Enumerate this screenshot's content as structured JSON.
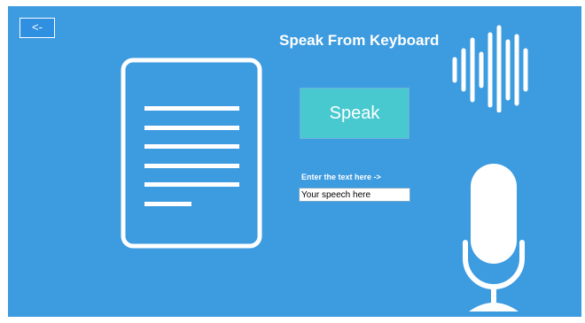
{
  "window": {
    "background": "#3d9be0"
  },
  "toolbar": {
    "back_label": "<-"
  },
  "header": {
    "title": "Speak From Keyboard"
  },
  "main": {
    "speak_label": "Speak",
    "speak_color": "#48c9cf",
    "input_label": "Enter the text here ->",
    "input_value": "Your speech here"
  },
  "icons": {
    "document": "document-icon",
    "soundwave": "soundwave-icon",
    "microphone": "microphone-icon"
  }
}
